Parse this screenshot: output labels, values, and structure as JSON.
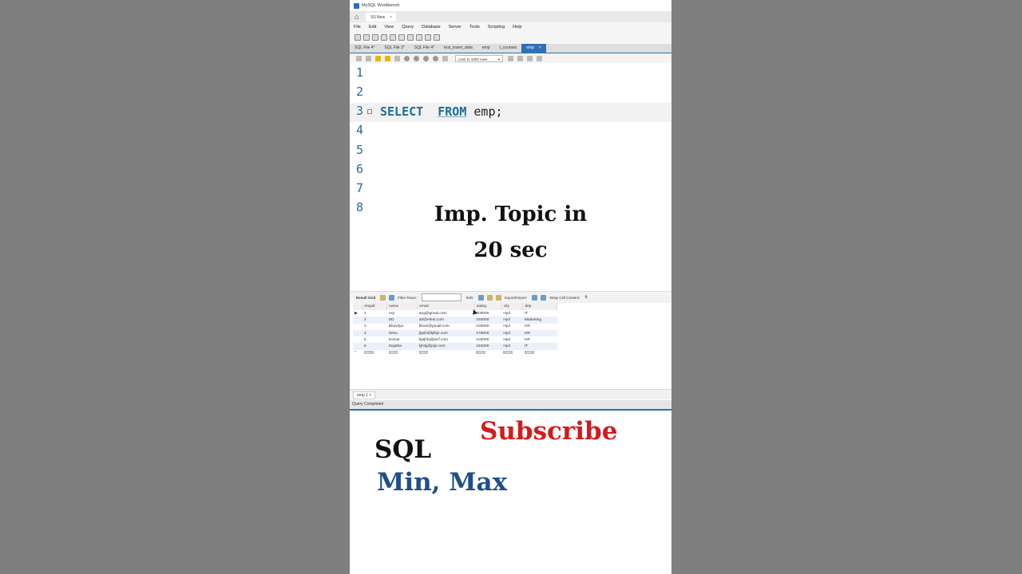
{
  "window": {
    "title": "MySQL Workbench",
    "connection_tab": "SS New"
  },
  "menu": [
    "File",
    "Edit",
    "View",
    "Query",
    "Database",
    "Server",
    "Tools",
    "Scripting",
    "Help"
  ],
  "editor_tabs": [
    {
      "label": "SQL File 4*",
      "active": false
    },
    {
      "label": "SQL File 3*",
      "active": false
    },
    {
      "label": "SQL File 4*",
      "active": false
    },
    {
      "label": "test_insert_data",
      "active": false
    },
    {
      "label": "emp",
      "active": false
    },
    {
      "label": "t_courses",
      "active": false
    },
    {
      "label": "emp",
      "active": true
    }
  ],
  "editor_toolbar": {
    "limit_label": "Limit to 1000 rows"
  },
  "editor": {
    "line_numbers": [
      "1",
      "2",
      "3",
      "4",
      "5",
      "6",
      "7",
      "8"
    ],
    "code": {
      "kw1": "SELECT",
      "space": "  ",
      "kw2": "FROM",
      "rest": " emp;"
    }
  },
  "overlay": {
    "line1": "Imp. Topic in",
    "line2": "20 sec"
  },
  "result_toolbar": {
    "result_grid": "Result Grid",
    "filter_rows": "Filter Rows:",
    "edit": "Edit:",
    "export_import": "Export/Import:",
    "wrap": "Wrap Cell Content:"
  },
  "grid": {
    "columns": [
      "empid",
      "name",
      "email",
      "salary",
      "city",
      "dep"
    ],
    "rows": [
      [
        "1",
        "Arp",
        "arpj@gmail.com",
        "200000",
        "Hyd",
        "IT"
      ],
      [
        "2",
        "DD",
        "dd@efeet.com",
        "150000",
        "Hyd",
        "Marketing"
      ],
      [
        "3",
        "Bhavitya",
        "bhavi@gmail.com",
        "100000",
        "Hyd",
        "HR"
      ],
      [
        "4",
        "Srinu",
        "jfgsh@kjfkjs.com",
        "175000",
        "Hyd",
        "HR"
      ],
      [
        "5",
        "Kumar",
        "fgsjhhj@jscf.com",
        "102000",
        "Hyd",
        "HR"
      ],
      [
        "6",
        "Sujatha",
        "kjhsjj@jsjs.com",
        "152000",
        "Hyd",
        "IT"
      ]
    ],
    "null_label": "NULL"
  },
  "bottom": {
    "result_tab": "emp 1",
    "status": "Query Completed"
  },
  "promo": {
    "subscribe": "Subscribe",
    "sql": "SQL",
    "minmax": "Min, Max"
  },
  "colors": {
    "accent": "#2f6fb8",
    "subscribe": "#d41b1b",
    "minmax": "#1f4e8a",
    "keyword": "#1b6c9f"
  }
}
